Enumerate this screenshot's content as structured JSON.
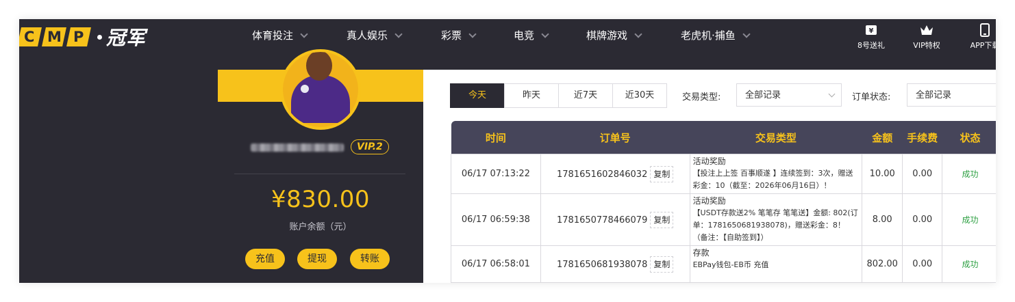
{
  "brand": {
    "logo_letters": [
      "C",
      "M",
      "P"
    ],
    "logo_cn": "冠军",
    "accent": "#f7c21b",
    "dark": "#2b2a33"
  },
  "nav": {
    "items": [
      {
        "label": "体育投注"
      },
      {
        "label": "真人娱乐"
      },
      {
        "label": "彩票"
      },
      {
        "label": "电竞"
      },
      {
        "label": "棋牌游戏"
      },
      {
        "label": "老虎机·捕鱼"
      }
    ],
    "quick": [
      {
        "label": "8号送礼",
        "icon": "gift-ticket-icon"
      },
      {
        "label": "VIP特权",
        "icon": "crown-icon"
      },
      {
        "label": "APP下载",
        "icon": "phone-icon"
      }
    ]
  },
  "profile": {
    "vip": "VIP.2",
    "balance": "¥830.00",
    "balance_label": "账户余额（元）",
    "actions": {
      "deposit": "充值",
      "withdraw": "提现",
      "transfer": "转账"
    }
  },
  "filters": {
    "tabs": [
      "今天",
      "昨天",
      "近7天",
      "近30天"
    ],
    "active_tab": "今天",
    "type_label": "交易类型:",
    "type_value": "全部记录",
    "status_label": "订单状态:",
    "status_value": "全部记录"
  },
  "table": {
    "headers": [
      "时间",
      "订单号",
      "交易类型",
      "金额",
      "手续费",
      "状态"
    ],
    "copy_label": "复制",
    "rows": [
      {
        "time": "06/17 07:13:22",
        "order": "1781651602846032",
        "type": "活动奖励",
        "desc": "【投注上上签 百事顺遂 】连续签到：3次，赠送彩金：10（截至：2026年06月16日）！",
        "amount": "10.00",
        "fee": "0.00",
        "status": "成功"
      },
      {
        "time": "06/17 06:59:38",
        "order": "1781650778466079",
        "type": "活动奖励",
        "desc": "【USDT存款送2% 笔笔存 笔笔送】金额: 802(订单：1781650681938078)，赠送彩金：8！（备注：【自助签到】）",
        "amount": "8.00",
        "fee": "0.00",
        "status": "成功"
      },
      {
        "time": "06/17 06:58:01",
        "order": "1781650681938078",
        "type": "存款",
        "desc": "EBPay钱包-EB币 充值",
        "amount": "802.00",
        "fee": "0.00",
        "status": "成功"
      }
    ]
  }
}
